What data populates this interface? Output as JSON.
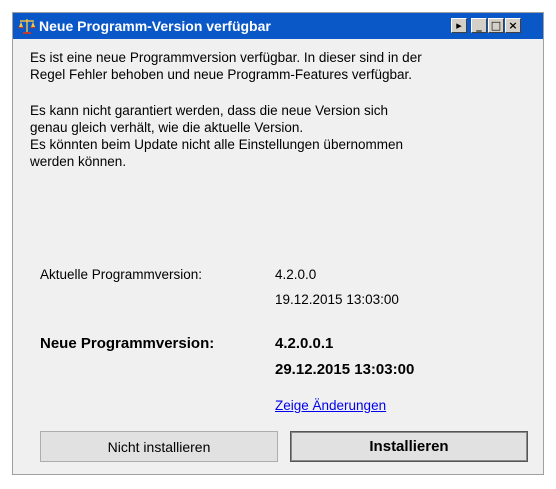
{
  "window": {
    "title": "Neue Programm-Version verfügbar",
    "controls": {
      "extra": "▸",
      "minimize": "_",
      "maximize": "□",
      "close": "×"
    }
  },
  "message": {
    "paragraph1_line1": "Es ist eine neue Programmversion verfügbar. In dieser sind in der",
    "paragraph1_line2": "Regel Fehler behoben und neue Programm-Features verfügbar.",
    "paragraph2_line1": "Es kann nicht garantiert werden, dass die neue Version sich",
    "paragraph2_line2": "genau gleich verhält, wie die aktuelle Version.",
    "paragraph2_line3": "Es könnten beim Update nicht alle Einstellungen übernommen",
    "paragraph2_line4": "werden können."
  },
  "current_version": {
    "label": "Aktuelle Programmversion:",
    "version": "4.2.0.0",
    "date": "19.12.2015 13:03:00"
  },
  "new_version": {
    "label": "Neue Programmversion:",
    "version": "4.2.0.0.1",
    "date": "29.12.2015 13:03:00"
  },
  "changes_link": "Zeige Änderungen",
  "buttons": {
    "skip": "Nicht installieren",
    "install": "Installieren"
  },
  "colors": {
    "titlebar": "#0a57c8",
    "link": "#0000ee"
  }
}
